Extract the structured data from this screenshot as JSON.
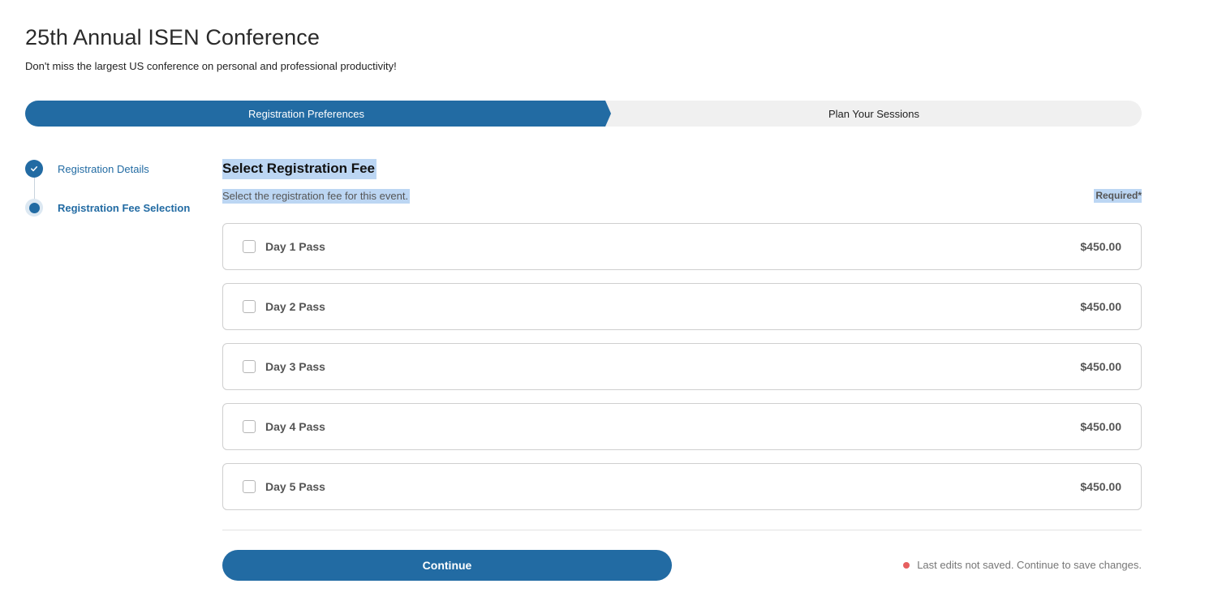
{
  "header": {
    "title": "25th Annual ISEN Conference",
    "subtitle": "Don't miss the largest US conference on personal and professional productivity!"
  },
  "progress": {
    "steps": [
      {
        "label": "Registration Preferences",
        "state": "active"
      },
      {
        "label": "Plan Your Sessions",
        "state": "upcoming"
      }
    ],
    "active_color": "#226ba3"
  },
  "sidebar": {
    "steps": [
      {
        "label": "Registration Details",
        "state": "completed",
        "icon": "check-icon"
      },
      {
        "label": "Registration Fee Selection",
        "state": "current",
        "icon": "current-step-dot-icon"
      }
    ]
  },
  "main": {
    "section_title": "Select Registration Fee",
    "section_description": "Select the registration fee for this event.",
    "required_label": "Required*",
    "fees": [
      {
        "name": "Day 1 Pass",
        "price": "$450.00",
        "checked": false
      },
      {
        "name": "Day 2 Pass",
        "price": "$450.00",
        "checked": false
      },
      {
        "name": "Day 3 Pass",
        "price": "$450.00",
        "checked": false
      },
      {
        "name": "Day 4 Pass",
        "price": "$450.00",
        "checked": false
      },
      {
        "name": "Day 5 Pass",
        "price": "$450.00",
        "checked": false
      }
    ]
  },
  "footer": {
    "continue_label": "Continue",
    "save_status": "Last edits not saved. Continue to save changes.",
    "status_color": "#e65f5f"
  }
}
